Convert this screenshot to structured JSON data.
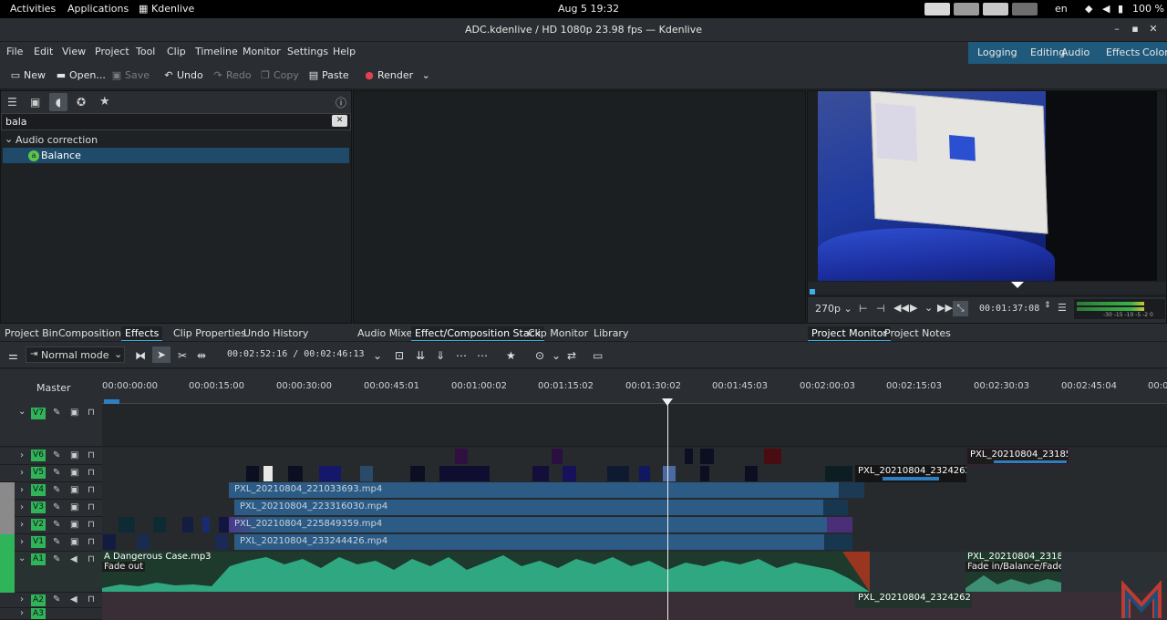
{
  "topbar": {
    "activities": "Activities",
    "applications": "Applications",
    "app_name": "Kdenlive",
    "clock": "Aug 5  19:32",
    "lang": "en",
    "battery": "100 %"
  },
  "window": {
    "title": "ADC.kdenlive / HD 1080p 23.98 fps — Kdenlive"
  },
  "menu": [
    "File",
    "Edit",
    "View",
    "Project",
    "Tool",
    "Clip",
    "Timeline",
    "Monitor",
    "Settings",
    "Help"
  ],
  "workspaces": [
    "Logging",
    "Editing",
    "Audio",
    "Effects",
    "Color"
  ],
  "toolbar": {
    "new": "New",
    "open": "Open...",
    "save": "Save",
    "undo": "Undo",
    "redo": "Redo",
    "copy": "Copy",
    "paste": "Paste",
    "render": "Render"
  },
  "effects": {
    "search_value": "bala",
    "category": "Audio correction",
    "item": "Balance",
    "item_badge": "a"
  },
  "tabs_left": [
    "Project Bin",
    "Compositions",
    "Effects",
    "Clip Properties",
    "Undo History"
  ],
  "tabs_mid": [
    "Audio Mixer",
    "Effect/Composition Stack",
    "Clip Monitor",
    "Library"
  ],
  "tabs_right": [
    "Project Monitor",
    "Project Notes"
  ],
  "monitor": {
    "resolution": "270p",
    "timecode": "00:01:37:08",
    "meter_labels": [
      "-30",
      "-15",
      "-10",
      "-5",
      "-2",
      "0"
    ]
  },
  "timeline_toolbar": {
    "mode": "Normal mode",
    "position": "00:02:52:16 / 00:02:46:13"
  },
  "timeline": {
    "master": "Master",
    "ruler": [
      "00:00:00:00",
      "00:00:15:00",
      "00:00:30:00",
      "00:00:45:01",
      "00:01:00:02",
      "00:01:15:02",
      "00:01:30:02",
      "00:01:45:03",
      "00:02:00:03",
      "00:02:15:03",
      "00:02:30:03",
      "00:02:45:04",
      "00:0"
    ],
    "tracks": [
      "V7",
      "V6",
      "V5",
      "V4",
      "V3",
      "V2",
      "V1",
      "A1",
      "A2",
      "A3"
    ],
    "clips": {
      "v6_right": "PXL_20210804_23185",
      "v5_right": "PXL_20210804_2324262",
      "v4": "PXL_20210804_221033693.mp4",
      "v3": "PXL_20210804_223316030.mp4",
      "v2": "PXL_20210804_225849359.mp4",
      "v1": "PXL_20210804_233244426.mp4",
      "a1_name": "A Dangerous Case.mp3",
      "a1_effect": "Fade out",
      "a1_right_name": "PXL_20210804_2318",
      "a1_right_effect": "Fade in/Balance/Fade",
      "a2_name": "PXL_20210804_2324262"
    }
  },
  "colors": {
    "accent": "#3daee9",
    "track_label": "#2fb45a",
    "video_clip": "#2c5b85",
    "audio_clip": "#1f6b50",
    "render_dot": "#e04150"
  }
}
